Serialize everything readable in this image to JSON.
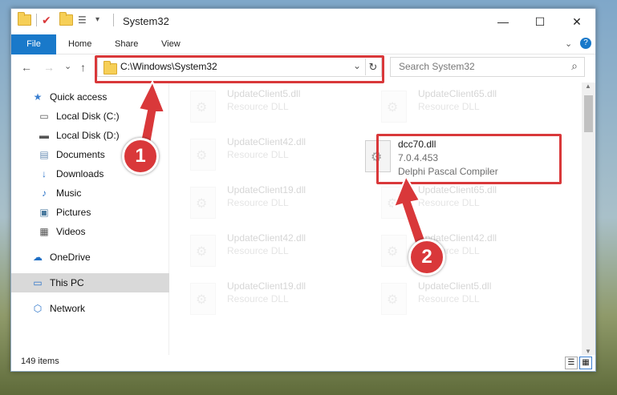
{
  "window": {
    "title": "System32",
    "minimize": "—",
    "maximize": "☐",
    "close": "✕"
  },
  "ribbon": {
    "file": "File",
    "home": "Home",
    "share": "Share",
    "view": "View",
    "expand": "⌄",
    "help": "?"
  },
  "nav": {
    "back": "←",
    "forward": "→",
    "recent": "⌄",
    "up": "↑"
  },
  "address": {
    "path": "C:\\Windows\\System32",
    "dropdown": "⌄",
    "refresh": "↻"
  },
  "search": {
    "placeholder": "Search System32",
    "icon": "⌕"
  },
  "sidebar": {
    "items": [
      {
        "label": "Quick access",
        "icon": "star-icon",
        "glyph": "★",
        "color": "#3a7fd0"
      },
      {
        "label": "Local Disk (C:)",
        "icon": "drive-icon",
        "glyph": "▭",
        "pinned": true
      },
      {
        "label": "Local Disk (D:)",
        "icon": "drive-icon",
        "glyph": "▬",
        "pinned": true
      },
      {
        "label": "Documents",
        "icon": "documents-icon",
        "glyph": "▤",
        "pinned": true
      },
      {
        "label": "Downloads",
        "icon": "download-icon",
        "glyph": "↓",
        "pinned": true
      },
      {
        "label": "Music",
        "icon": "music-icon",
        "glyph": "♪",
        "pinned": true
      },
      {
        "label": "Pictures",
        "icon": "pictures-icon",
        "glyph": "▣",
        "pinned": true
      },
      {
        "label": "Videos",
        "icon": "videos-icon",
        "glyph": "▦",
        "pinned": true
      },
      {
        "label": "OneDrive",
        "icon": "cloud-icon",
        "glyph": "☁"
      },
      {
        "label": "This PC",
        "icon": "computer-icon",
        "glyph": "▭",
        "selected": true
      },
      {
        "label": "Network",
        "icon": "network-icon",
        "glyph": "⬡"
      }
    ],
    "pin_glyph": "📌"
  },
  "files": {
    "left": [
      {
        "name": "UpdateClient5.dll",
        "desc": "Resource DLL"
      },
      {
        "name": "UpdateClient42.dll",
        "desc": "Resource DLL"
      },
      {
        "name": "UpdateClient19.dll",
        "desc": "Resource DLL"
      },
      {
        "name": "UpdateClient42.dll",
        "desc": "Resource DLL"
      },
      {
        "name": "UpdateClient19.dll",
        "desc": "Resource DLL"
      }
    ],
    "right": [
      {
        "name": "UpdateClient65.dll",
        "desc": "Resource DLL"
      },
      {
        "name": "UpdateClient65.dll",
        "desc": "Resource DLL"
      },
      {
        "name": "UpdateClient42.dll",
        "desc": "Resource DLL"
      },
      {
        "name": "UpdateClient5.dll",
        "desc": "Resource DLL"
      }
    ],
    "highlighted": {
      "name": "dcc70.dll",
      "version": "7.0.4.453",
      "desc": "Delphi Pascal Compiler"
    }
  },
  "status": {
    "count": "149 items"
  },
  "callouts": {
    "one": "1",
    "two": "2"
  },
  "colors": {
    "accent": "#1979ca",
    "highlight": "#d9383a"
  }
}
